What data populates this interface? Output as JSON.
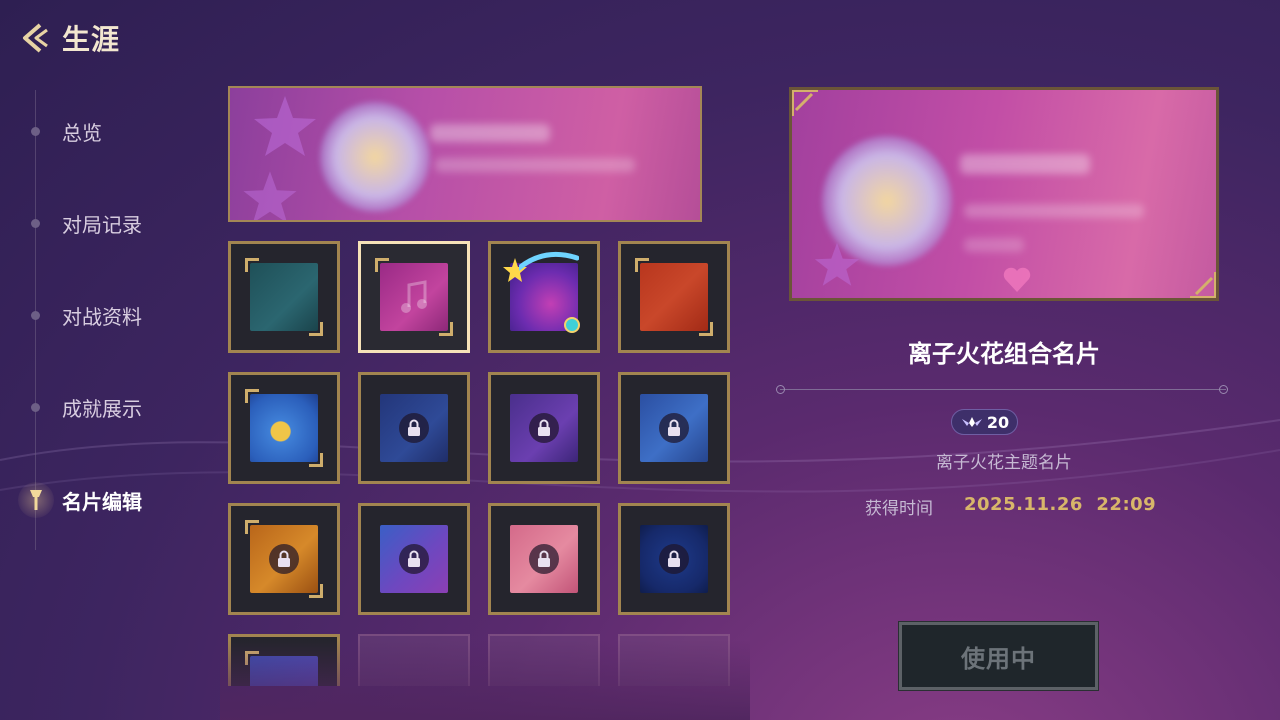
{
  "header": {
    "title": "生涯",
    "back_icon": "chevron-left-icon"
  },
  "sidebar": {
    "items": [
      {
        "label": "总览",
        "active": false
      },
      {
        "label": "对局记录",
        "active": false
      },
      {
        "label": "对战资料",
        "active": false
      },
      {
        "label": "成就展示",
        "active": false
      },
      {
        "label": "名片编辑",
        "active": true
      }
    ]
  },
  "grid": {
    "tiles": [
      {
        "theme": "teal",
        "locked": false,
        "selected": false
      },
      {
        "theme": "magenta-music",
        "locked": false,
        "selected": true
      },
      {
        "theme": "purple-star",
        "locked": false,
        "selected": false
      },
      {
        "theme": "red-orange",
        "locked": false,
        "selected": false
      },
      {
        "theme": "blue-moon",
        "locked": false,
        "selected": false
      },
      {
        "theme": "navy-ornate",
        "locked": true,
        "selected": false
      },
      {
        "theme": "violet-ornate",
        "locked": true,
        "selected": false
      },
      {
        "theme": "blue-key",
        "locked": true,
        "selected": false
      },
      {
        "theme": "amber",
        "locked": true,
        "selected": false
      },
      {
        "theme": "indigo-wizard",
        "locked": true,
        "selected": false
      },
      {
        "theme": "pink-cat",
        "locked": true,
        "selected": false
      },
      {
        "theme": "deep-blue-frost",
        "locked": true,
        "selected": false
      },
      {
        "theme": "blue-partial",
        "locked": true,
        "selected": false
      },
      {
        "theme": "empty",
        "locked": false,
        "selected": false
      },
      {
        "theme": "empty",
        "locked": false,
        "selected": false
      },
      {
        "theme": "empty",
        "locked": false,
        "selected": false
      }
    ]
  },
  "detail": {
    "name": "离子火花组合名片",
    "price": "20",
    "description": "离子火花主题名片",
    "acquire_label": "获得时间",
    "acquire_time": "2025.11.26  22:09",
    "use_button": "使用中"
  },
  "colors": {
    "gold": "#cfae6c",
    "tile_border": "#a28550",
    "selected_border": "#f6e2b8",
    "time_gold": "#d8b66a"
  }
}
